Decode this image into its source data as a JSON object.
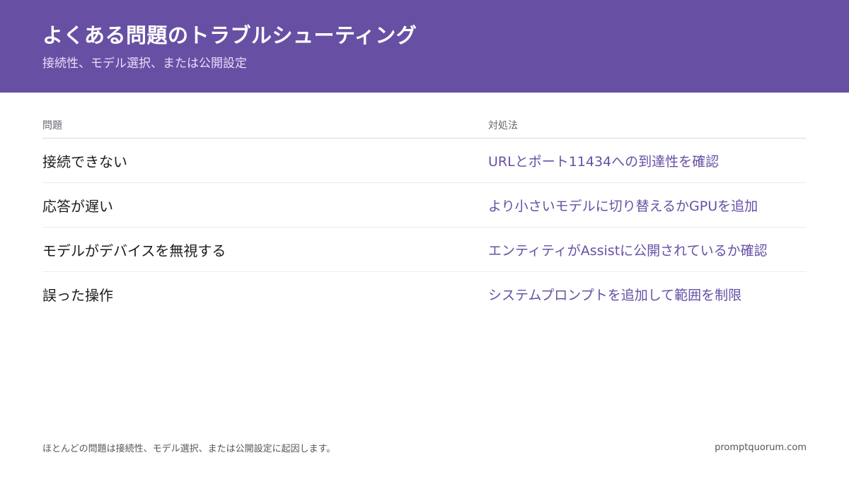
{
  "header": {
    "title": "よくある問題のトラブルシューティング",
    "subtitle": "接続性、モデル選択、または公開設定"
  },
  "table": {
    "columns": [
      "問題",
      "対処法"
    ],
    "rows": [
      {
        "problem": "接続できない",
        "fix": "URLとポート11434への到達性を確認"
      },
      {
        "problem": "応答が遅い",
        "fix": "より小さいモデルに切り替えるかGPUを追加"
      },
      {
        "problem": "モデルがデバイスを無視する",
        "fix": "エンティティがAssistに公開されているか確認"
      },
      {
        "problem": "誤った操作",
        "fix": "システムプロンプトを追加して範囲を制限"
      }
    ]
  },
  "footer": {
    "note": "ほとんどの問題は接続性、モデル選択、または公開設定に起因します。",
    "brand": "promptquorum.com"
  },
  "colors": {
    "accent": "#6750a4",
    "header_text": "#ffffff"
  }
}
